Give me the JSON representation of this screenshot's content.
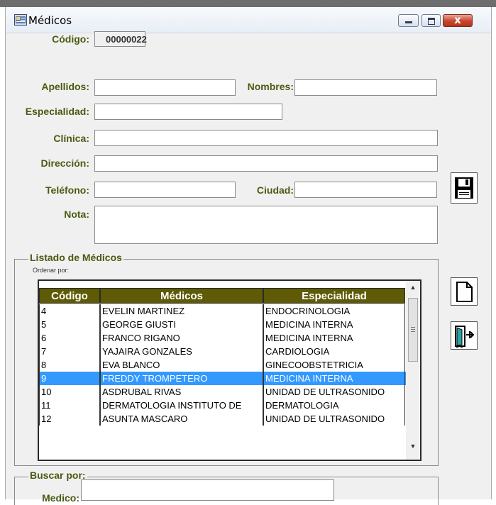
{
  "window": {
    "title": "Médicos",
    "close_label": "x"
  },
  "form": {
    "codigo_label": "Código:",
    "codigo_value": "00000022",
    "apellidos_label": "Apellidos:",
    "apellidos_value": "",
    "nombres_label": "Nombres:",
    "nombres_value": "",
    "especialidad_label": "Especialidad:",
    "especialidad_value": "",
    "clinica_label": "Clínica:",
    "clinica_value": "",
    "direccion_label": "Dirección:",
    "direccion_value": "",
    "telefono_label": "Teléfono:",
    "telefono_value": "",
    "ciudad_label": "Ciudad:",
    "ciudad_value": "",
    "nota_label": "Nota:",
    "nota_value": ""
  },
  "listado": {
    "title": "Listado de Médicos",
    "sort_label": "Ordenar por:",
    "columns": [
      "Código",
      "Médicos",
      "Especialidad"
    ],
    "rows": [
      {
        "codigo": "4",
        "medico": "EVELIN  MARTINEZ",
        "especialidad": "ENDOCRINOLOGIA"
      },
      {
        "codigo": "5",
        "medico": "GEORGE GIUSTI",
        "especialidad": "MEDICINA INTERNA"
      },
      {
        "codigo": "6",
        "medico": "FRANCO RIGANO",
        "especialidad": "MEDICINA INTERNA"
      },
      {
        "codigo": "7",
        "medico": "YAJAIRA GONZALES",
        "especialidad": "CARDIOLOGIA"
      },
      {
        "codigo": "8",
        "medico": "EVA BLANCO",
        "especialidad": "GINECOOBSTETRICIA"
      },
      {
        "codigo": "9",
        "medico": "FREDDY  TROMPETERO",
        "especialidad": "MEDICINA INTERNA",
        "selected": true
      },
      {
        "codigo": "10",
        "medico": "ASDRUBAL  RIVAS",
        "especialidad": "UNIDAD DE ULTRASONIDO"
      },
      {
        "codigo": "11",
        "medico": "DERMATOLOGIA  INSTITUTO DE",
        "especialidad": "DERMATOLOGIA"
      },
      {
        "codigo": "12",
        "medico": "ASUNTA  MASCARO",
        "especialidad": "UNIDAD DE ULTRASONIDO"
      }
    ],
    "selection_color": "#3399ff",
    "header_color": "#5e5a05"
  },
  "buscar": {
    "title": "Buscar por:",
    "medico_label": "Medico:",
    "medico_value": ""
  },
  "icons": {
    "save": "floppy-disk-icon",
    "new": "new-document-icon",
    "exit": "exit-door-icon"
  },
  "colors": {
    "label": "#4a5b12",
    "window_bg": "#f0f0f0"
  }
}
